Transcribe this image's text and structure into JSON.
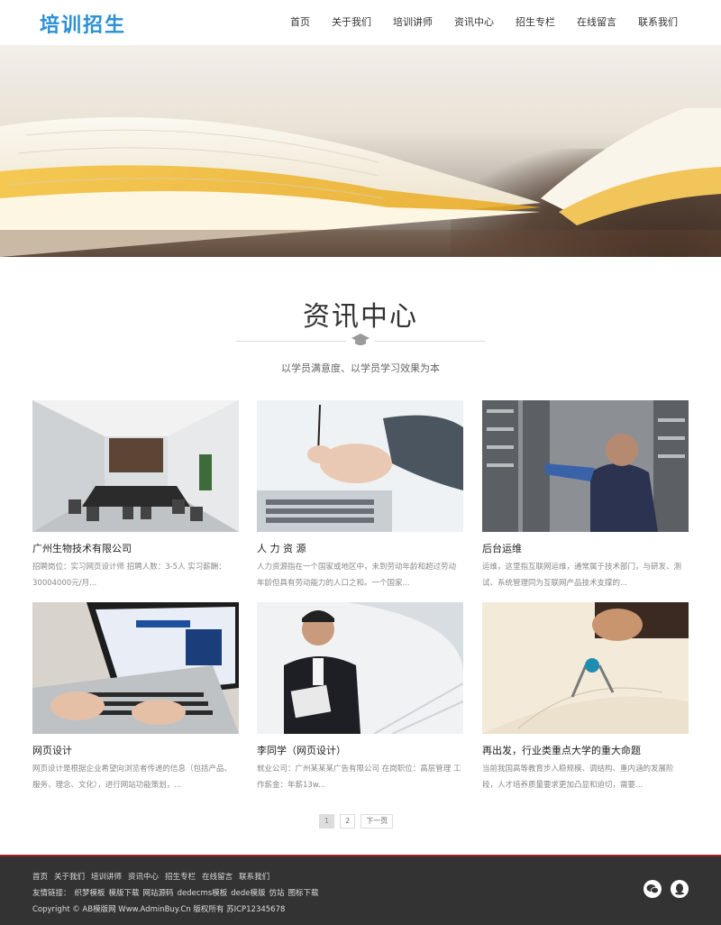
{
  "header": {
    "logo": "培训招生",
    "nav": [
      "首页",
      "关于我们",
      "培训讲师",
      "资讯中心",
      "招生专栏",
      "在线留言",
      "联系我们"
    ]
  },
  "section": {
    "title": "资讯中心",
    "subtitle": "以学员满意度、以学员学习效果为本"
  },
  "cards": [
    {
      "title": "广州生物技术有限公司",
      "desc": "招聘岗位：实习网页设计师 招聘人数：3-5人 实习薪酬：30004000元/月..."
    },
    {
      "title": "人 力 资 源",
      "desc": "人力资源指在一个国家或地区中，未到劳动年龄和超过劳动年龄但具有劳动能力的人口之和。一个国家..."
    },
    {
      "title": "后台运维",
      "desc": "运维，这里指互联网运维，通常属于技术部门，与研发、测试、系统管理同为互联网产品技术支撑的..."
    },
    {
      "title": "网页设计",
      "desc": "网页设计是根据企业希望向浏览者传递的信息（包括产品、服务、理念、文化），进行网站功能策划，..."
    },
    {
      "title": "李同学（网页设计）",
      "desc": "就业公司：广州某某某广告有限公司 在岗职位：高层管理 工作薪金：年薪13w..."
    },
    {
      "title": "再出发，行业类重点大学的重大命题",
      "desc": "当前我国高等教育步入稳规模、调结构、重内涵的发展阶段，人才培养质量要求更加凸显和迫切，需要..."
    }
  ],
  "pager": {
    "pages": [
      "1",
      "2"
    ],
    "next": "下一页"
  },
  "footer": {
    "links": [
      "首页",
      "关于我们",
      "培训讲师",
      "资讯中心",
      "招生专栏",
      "在线留言",
      "联系我们"
    ],
    "friend_label": "友情链接：",
    "friend_links": [
      "织梦模板",
      "模版下载",
      "网站源码",
      "dedecms模板",
      "dede模版",
      "仿站",
      "图标下载"
    ],
    "copyright": "Copyright © AB模版网 Www.AdminBuy.Cn 版权所有   苏ICP12345678",
    "icons": [
      "wechat-icon",
      "qq-icon"
    ]
  },
  "colors": {
    "brand": "#2a8fd6",
    "footer_bg": "#333333",
    "footer_accent": "#a81f24"
  }
}
